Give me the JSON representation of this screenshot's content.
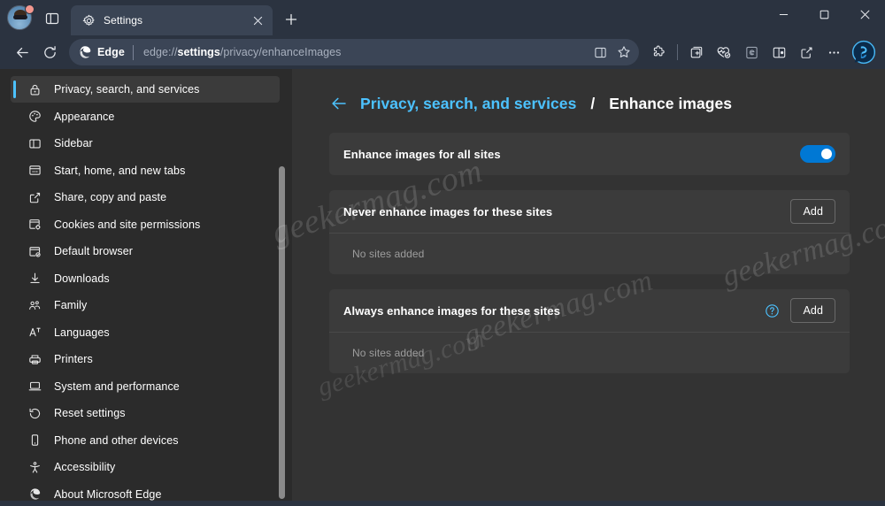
{
  "window": {
    "controls": {
      "minimize": "minimize",
      "maximize": "maximize",
      "close": "close"
    }
  },
  "tabstrip": {
    "profile_label": "profile",
    "tab_actions_label": "tab actions menu",
    "new_tab_label": "New tab",
    "tabs": [
      {
        "title": "Settings",
        "favicon": "gear-icon",
        "active": true,
        "close_label": "Close tab"
      }
    ]
  },
  "toolbar": {
    "back_label": "Back",
    "refresh_label": "Refresh",
    "omnibox": {
      "brand": "Edge",
      "url_prefix": "edge://",
      "url_strong": "settings",
      "url_suffix": "/privacy/enhanceImages",
      "full_url": "edge://settings/privacy/enhanceImages",
      "split_screen_label": "Split screen",
      "favorite_label": "Add this page to favorites"
    },
    "actions": [
      {
        "name": "extensions-icon",
        "label": "Extensions"
      },
      {
        "name": "collections-icon",
        "label": "Collections"
      },
      {
        "name": "browser-essentials-icon",
        "label": "Browser essentials"
      },
      {
        "name": "ie-mode-icon",
        "label": "Internet Explorer mode"
      },
      {
        "name": "split-screen-icon",
        "label": "Split screen"
      },
      {
        "name": "share-icon",
        "label": "Share"
      },
      {
        "name": "settings-more-icon",
        "label": "Settings and more"
      }
    ],
    "copilot_label": "Copilot"
  },
  "sidebar": {
    "items": [
      {
        "label": "Privacy, search, and services",
        "icon": "lock-icon",
        "selected": true
      },
      {
        "label": "Appearance",
        "icon": "palette-icon",
        "selected": false
      },
      {
        "label": "Sidebar",
        "icon": "sidebar-icon",
        "selected": false
      },
      {
        "label": "Start, home, and new tabs",
        "icon": "home-page-icon",
        "selected": false
      },
      {
        "label": "Share, copy and paste",
        "icon": "share-icon",
        "selected": false
      },
      {
        "label": "Cookies and site permissions",
        "icon": "cookies-icon",
        "selected": false
      },
      {
        "label": "Default browser",
        "icon": "default-browser-icon",
        "selected": false
      },
      {
        "label": "Downloads",
        "icon": "download-icon",
        "selected": false
      },
      {
        "label": "Family",
        "icon": "family-icon",
        "selected": false
      },
      {
        "label": "Languages",
        "icon": "languages-icon",
        "selected": false
      },
      {
        "label": "Printers",
        "icon": "printer-icon",
        "selected": false
      },
      {
        "label": "System and performance",
        "icon": "laptop-icon",
        "selected": false
      },
      {
        "label": "Reset settings",
        "icon": "reset-icon",
        "selected": false
      },
      {
        "label": "Phone and other devices",
        "icon": "phone-icon",
        "selected": false
      },
      {
        "label": "Accessibility",
        "icon": "accessibility-icon",
        "selected": false
      },
      {
        "label": "About Microsoft Edge",
        "icon": "edge-logo-icon",
        "selected": false
      }
    ]
  },
  "main": {
    "breadcrumb": {
      "back_label": "Back",
      "parent": "Privacy, search, and services",
      "separator": "/",
      "current": "Enhance images"
    },
    "cards": [
      {
        "title": "Enhance images for all sites",
        "type": "toggle",
        "toggle_on": true,
        "toggle_label": "Enhance images for all sites toggle"
      },
      {
        "title": "Never enhance images for these sites",
        "type": "site-list",
        "has_help": false,
        "add_label": "Add",
        "empty_text": "No sites added"
      },
      {
        "title": "Always enhance images for these sites",
        "type": "site-list",
        "has_help": true,
        "help_label": "Learn more",
        "add_label": "Add",
        "empty_text": "No sites added"
      }
    ]
  },
  "watermarks": {
    "text": "geekermag.com"
  },
  "colors": {
    "accent_blue": "#4cc2ff",
    "toggle_blue": "#0078d4",
    "page_bg": "#333333",
    "sidebar_bg": "#2b2b2b",
    "card_bg": "#3b3b3b",
    "chrome_bg": "#2b3340",
    "tab_active_bg": "#3a4454"
  }
}
